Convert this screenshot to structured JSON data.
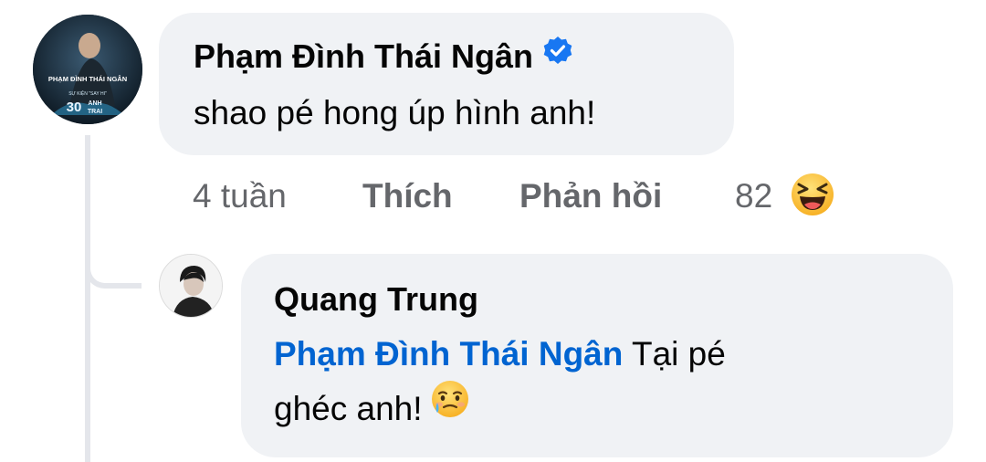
{
  "comment": {
    "author": "Phạm Đình Thái Ngân",
    "verified": true,
    "text": "shao pé hong úp hình anh!",
    "avatar": {
      "text_line1": "PHẠM ĐÌNH THÁI NGÂN",
      "text_line2": "SỰ KIỆN \"SAY HI\"",
      "text_line3": "30",
      "text_line4": "ANH",
      "text_line5": "TRAI"
    },
    "actions": {
      "time": "4 tuần",
      "like": "Thích",
      "reply": "Phản hồi",
      "reaction_count": "82",
      "reaction_icon": "laughing-face-icon"
    }
  },
  "reply": {
    "author": "Quang Trung",
    "mention": "Phạm Đình Thái Ngân",
    "text_line1": "Tại pé",
    "text_line2": "ghéc anh!",
    "emoji": "crying-smiling-face-icon"
  },
  "colors": {
    "bubble": "#f0f2f5",
    "mention": "#0064d1",
    "verified_badge": "#1877f2",
    "meta_text": "#65676b",
    "thread_line": "#e4e6eb"
  }
}
